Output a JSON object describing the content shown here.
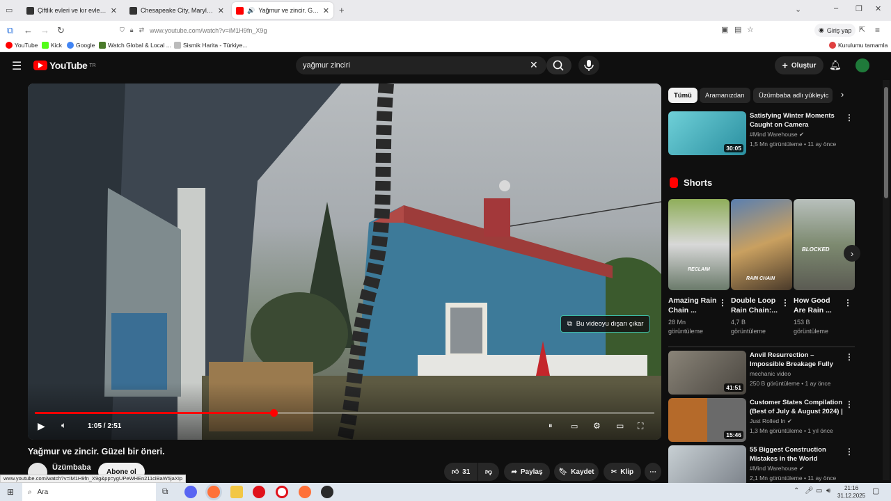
{
  "browser": {
    "tabs": [
      {
        "title": "Çiftlik evleri ve kır evleri satılık // Arıza...",
        "favicon_color": "#333333"
      },
      {
        "title": "Chesapeake City, Maryland, satılık...",
        "favicon_color": "#333333"
      },
      {
        "title": "Yağmur ve zincir. Güzel bir ö",
        "favicon_color": "#ff0000"
      }
    ],
    "new_tab": "+",
    "url": "www.youtube.com/watch?v=iM1H9fn_X9g",
    "signin": "Giriş yap",
    "bookmarks": [
      "YouTube",
      "Kick",
      "Google",
      "Watch Global & Local ...",
      "Sismik Harita - Türkiye..."
    ],
    "bookmarks_right": "Kurulumu tamamla",
    "status_url": "www.youtube.com/watch?v=iM1H9fn_X9g&pp=ygUPeWHEn211ciBaW5jaXIp"
  },
  "yt": {
    "logo": "YouTube",
    "logo_suffix": "TR",
    "search_query": "yağmur zinciri",
    "create_label": "Oluştur",
    "player": {
      "time": "1:05 / 2:51",
      "progress": 0.385,
      "pip_label": "Bu videoyu dışarı çıkar"
    },
    "video_title": "Yağmur ve zincir. Güzel bir öneri.",
    "channel": "Üzümbaba",
    "subscribe": "Abone ol",
    "actions": {
      "likes": "31",
      "share": "Paylaş",
      "save": "Kaydet",
      "clip": "Klip"
    },
    "chips": [
      "Tümü",
      "Aramanızdan",
      "Üzümbaba adlı yükleyic"
    ],
    "shorts_heading": "Shorts",
    "top_video": {
      "title": "Satisfying Winter Moments Caught on Camera",
      "channel": "#Mind Warehouse",
      "meta": "1,5 Mn görüntüleme • 11 ay önce",
      "duration": "30:05"
    },
    "shorts": [
      {
        "title": "Amazing Rain Chain ...",
        "views": "28 Mn",
        "views_label": "görüntüleme",
        "overlay": "RECLAIM"
      },
      {
        "title": "Double Loop Rain Chain:...",
        "views": "4,7 B",
        "views_label": "görüntüleme",
        "overlay": "RAIN CHAIN"
      },
      {
        "title": "How Good Are Rain ...",
        "views": "153 B",
        "views_label": "görüntüleme",
        "overlay": "BLOCKED"
      }
    ],
    "videos": [
      {
        "title": "Anvil Resurrection – Impossible Breakage Fully Repaired by ...",
        "channel": "mechanic video",
        "meta": "250 B görüntüleme • 1 ay önce",
        "duration": "41:51"
      },
      {
        "title": "Customer States Compilation (Best of July & August 2024) | ...",
        "channel": "Just Rolled In",
        "meta": "1,3 Mn görüntüleme • 1 yıl önce",
        "duration": "15:46"
      },
      {
        "title": "55 Biggest Construction Mistakes in the World",
        "channel": "#Mind Warehouse",
        "meta": "2,1 Mn görüntüleme • 11 ay önce",
        "duration": ""
      }
    ]
  },
  "taskbar": {
    "search": "Ara",
    "time": "21:16",
    "date": "31.12.2025"
  }
}
